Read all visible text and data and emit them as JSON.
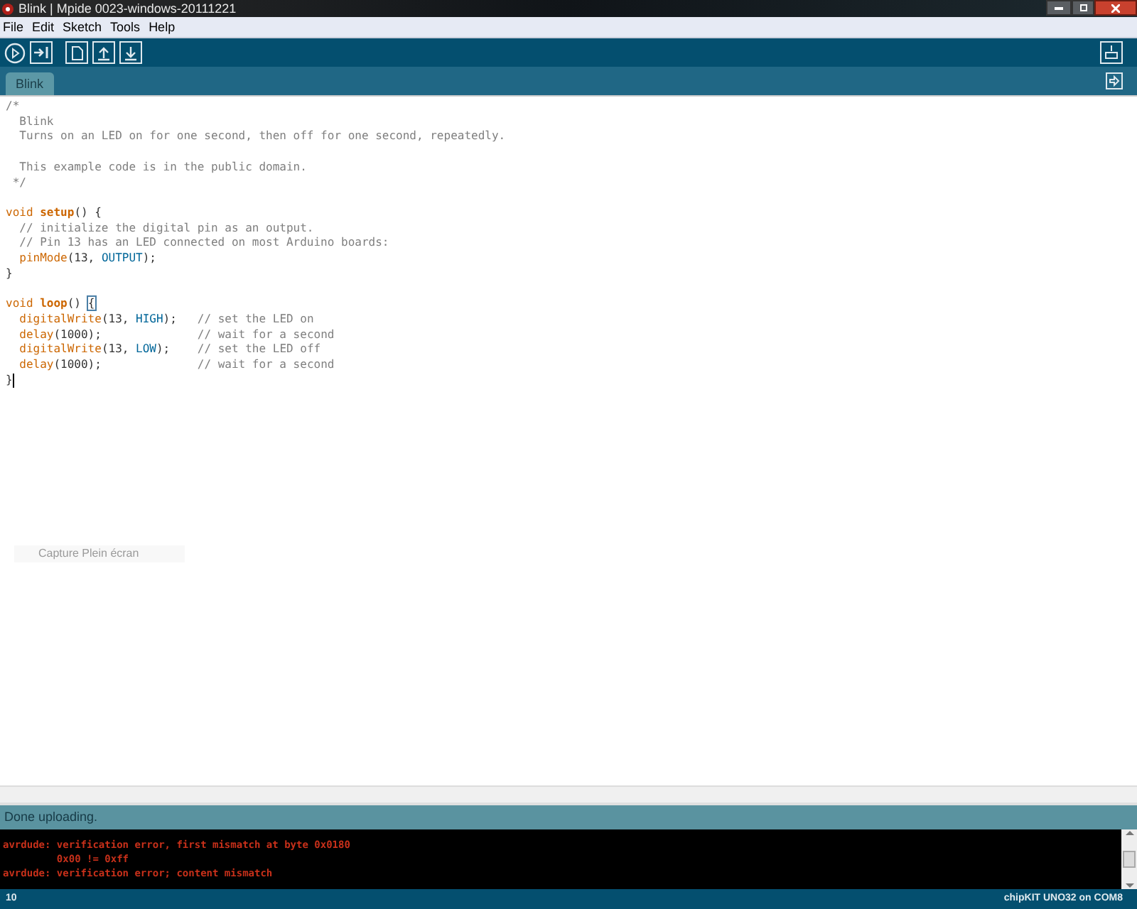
{
  "window": {
    "title": "Blink | Mpide 0023-windows-20111221"
  },
  "menu": [
    "File",
    "Edit",
    "Sketch",
    "Tools",
    "Help"
  ],
  "tabs": [
    {
      "label": "Blink",
      "selected": true
    }
  ],
  "editor": {
    "lines": [
      {
        "tokens": [
          {
            "kind": "comment",
            "text": "/*"
          }
        ]
      },
      {
        "tokens": [
          {
            "kind": "comment",
            "text": "  Blink"
          }
        ]
      },
      {
        "tokens": [
          {
            "kind": "comment",
            "text": "  Turns on an LED on for one second, then off for one second, repeatedly."
          }
        ]
      },
      {
        "kind": "blank"
      },
      {
        "tokens": [
          {
            "kind": "comment",
            "text": "  This example code is in the public domain."
          }
        ]
      },
      {
        "tokens": [
          {
            "kind": "comment",
            "text": " */"
          }
        ]
      },
      {
        "kind": "blank"
      },
      {
        "tokens": [
          {
            "kind": "keyword",
            "text": "void "
          },
          {
            "kind": "function_bold",
            "text": "setup"
          },
          {
            "kind": "plain",
            "text": "() {"
          }
        ]
      },
      {
        "tokens": [
          {
            "kind": "comment",
            "text": "  // initialize the digital pin as an output."
          }
        ]
      },
      {
        "tokens": [
          {
            "kind": "comment",
            "text": "  // Pin 13 has an LED connected on most Arduino boards:"
          }
        ]
      },
      {
        "tokens": [
          {
            "kind": "function",
            "text": "  pinMode"
          },
          {
            "kind": "plain",
            "text": "(13, "
          },
          {
            "kind": "constant",
            "text": "OUTPUT"
          },
          {
            "kind": "plain",
            "text": ");"
          }
        ]
      },
      {
        "tokens": [
          {
            "kind": "plain",
            "text": "}"
          }
        ]
      },
      {
        "kind": "blank"
      },
      {
        "tokens": [
          {
            "kind": "keyword",
            "text": "void "
          },
          {
            "kind": "function_bold",
            "text": "loop"
          },
          {
            "kind": "plain",
            "text": "() "
          },
          {
            "kind": "bracket_match",
            "text": "{"
          }
        ]
      },
      {
        "tokens": [
          {
            "kind": "function",
            "text": "  digitalWrite"
          },
          {
            "kind": "plain",
            "text": "(13, "
          },
          {
            "kind": "constant",
            "text": "HIGH"
          },
          {
            "kind": "plain",
            "text": ");   "
          },
          {
            "kind": "comment",
            "text": "// set the LED on"
          }
        ]
      },
      {
        "tokens": [
          {
            "kind": "function",
            "text": "  delay"
          },
          {
            "kind": "plain",
            "text": "(1000);              "
          },
          {
            "kind": "comment",
            "text": "// wait for a second"
          }
        ]
      },
      {
        "tokens": [
          {
            "kind": "function",
            "text": "  digitalWrite"
          },
          {
            "kind": "plain",
            "text": "(13, "
          },
          {
            "kind": "constant",
            "text": "LOW"
          },
          {
            "kind": "plain",
            "text": ");    "
          },
          {
            "kind": "comment",
            "text": "// set the LED off"
          }
        ]
      },
      {
        "tokens": [
          {
            "kind": "function",
            "text": "  delay"
          },
          {
            "kind": "plain",
            "text": "(1000);              "
          },
          {
            "kind": "comment",
            "text": "// wait for a second"
          }
        ]
      },
      {
        "tokens": [
          {
            "kind": "plain",
            "text": "}"
          }
        ],
        "cursor": true
      }
    ]
  },
  "overlay_label": "Capture Plein écran",
  "status": "Done uploading.",
  "console": [
    "avrdude: verification error, first mismatch at byte 0x0180",
    "         0x00 != 0xff",
    "avrdude: verification error; content mismatch"
  ],
  "footer": {
    "line": "10",
    "board": "chipKIT UNO32 on COM8"
  }
}
